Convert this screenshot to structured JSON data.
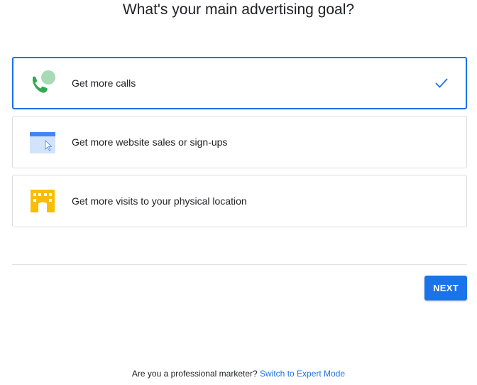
{
  "page": {
    "title": "What's your main advertising goal?"
  },
  "options": [
    {
      "label": "Get more calls",
      "icon": "phone-icon",
      "selected": true
    },
    {
      "label": "Get more website sales or sign-ups",
      "icon": "website-icon",
      "selected": false
    },
    {
      "label": "Get more visits to your physical location",
      "icon": "store-icon",
      "selected": false
    }
  ],
  "actions": {
    "next_label": "NEXT"
  },
  "footer": {
    "question": "Are you a professional marketer?",
    "link_label": "Switch to Expert Mode"
  },
  "colors": {
    "accent": "#1a73e8",
    "border": "#dadce0",
    "text": "#202124"
  }
}
